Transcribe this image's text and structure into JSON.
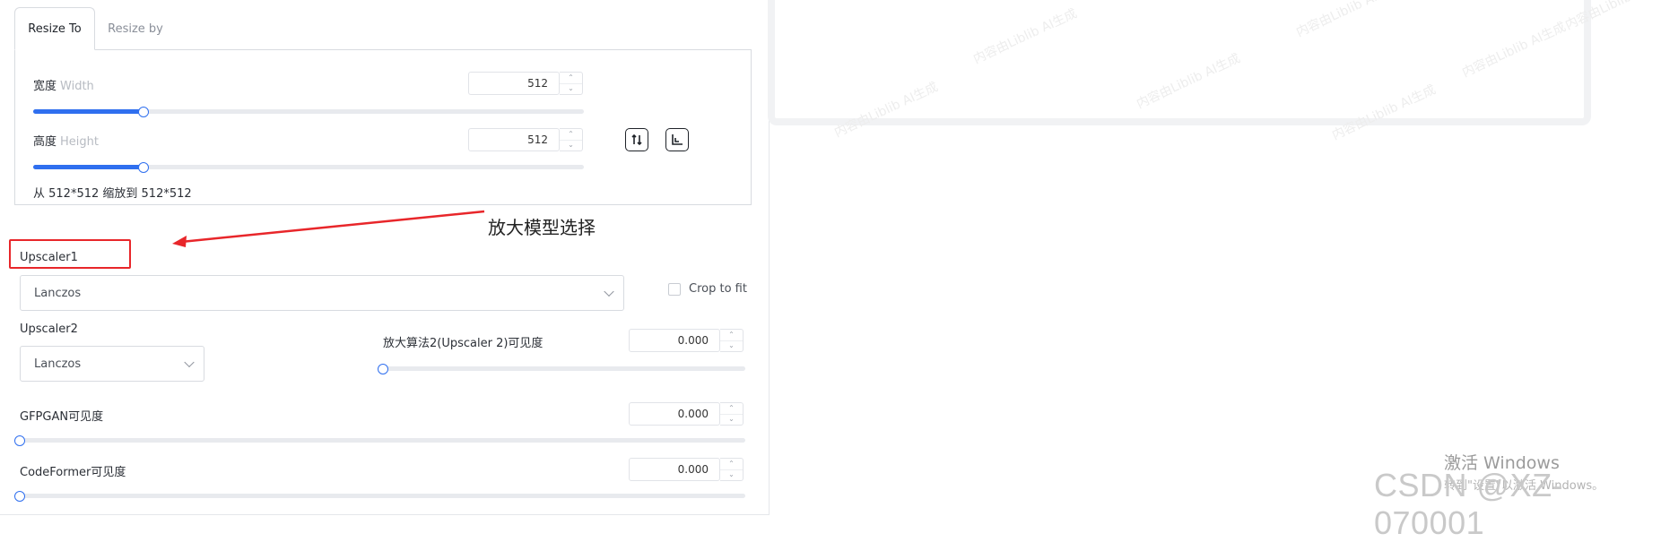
{
  "tabs": [
    {
      "label": "Resize To",
      "active": true
    },
    {
      "label": "Resize by",
      "active": false
    }
  ],
  "width": {
    "label": "宽度",
    "sublabel": "Width",
    "value": "512",
    "slider_fraction": 0.2
  },
  "height": {
    "label": "高度",
    "sublabel": "Height",
    "value": "512",
    "slider_fraction": 0.2
  },
  "scale_text": "从 512*512 缩放到 512*512",
  "icons": {
    "swap": "swap-icon",
    "aspect": "aspect-ratio-icon"
  },
  "annotation": {
    "text": "放大模型选择",
    "color": "#e8262a"
  },
  "upscaler1": {
    "label": "Upscaler1",
    "value": "Lanczos"
  },
  "crop_to_fit": {
    "label": "Crop to fit",
    "checked": false
  },
  "upscaler2": {
    "label": "Upscaler2",
    "value": "Lanczos"
  },
  "upscaler2_visibility": {
    "label": "放大算法2(Upscaler 2)可见度",
    "value": "0.000",
    "slider_fraction": 0.0
  },
  "gfpgan": {
    "label": "GFPGAN可见度",
    "value": "0.000",
    "slider_fraction": 0.0
  },
  "codeformer": {
    "label": "CodeFormer可见度",
    "value": "0.000",
    "slider_fraction": 0.0
  },
  "preview_watermarks": [
    "内容由Liblib AI生成",
    "内容由Liblib AI生成",
    "内容由Liblib AI生成",
    "内容由Liblib AI生成",
    "内容由Liblib AI生成",
    "内容由Liblib AI生成",
    "内容由Liblib AI生成"
  ],
  "os_watermark": {
    "title": "激活 Windows",
    "subtitle": "转到\"设置\"以激活 Windows。"
  },
  "csdn_watermark": "CSDN @XZ-070001",
  "colors": {
    "accent": "#2f6fef",
    "annotation_red": "#e8262a"
  }
}
